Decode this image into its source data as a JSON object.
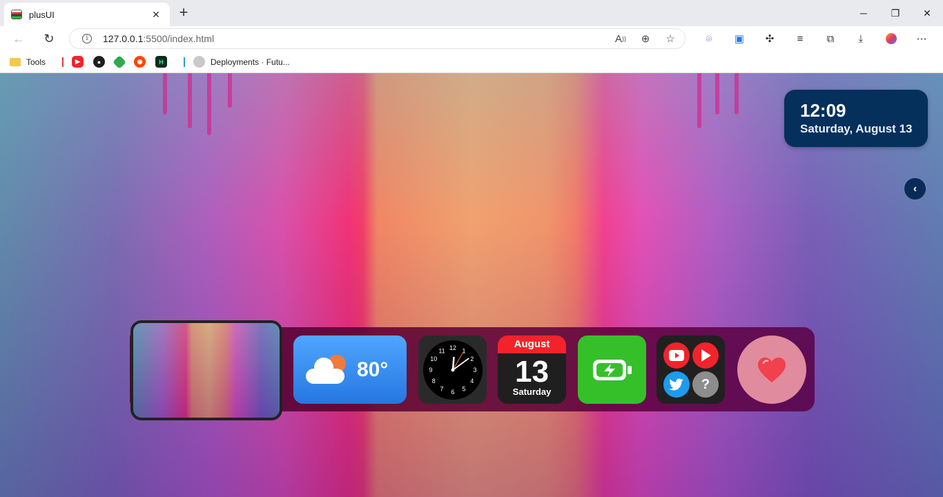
{
  "browser": {
    "tab_title": "plusUI",
    "new_tab_symbol": "+",
    "url_host": "127.0.0.1",
    "url_rest": ":5500/index.html",
    "window_controls": [
      "minimize-icon",
      "restore-icon",
      "close-icon"
    ]
  },
  "bookmarks": {
    "folder_label": "Tools",
    "deployments_label": "Deployments · Futu..."
  },
  "widgets": {
    "clock": {
      "time": "12:09",
      "date": "Saturday, August 13"
    },
    "weather": {
      "temperature": "80°"
    },
    "calendar": {
      "month": "August",
      "day": "13",
      "weekday": "Saturday"
    },
    "analog_clock": {
      "hour": 12,
      "minute": 9,
      "numbers": [
        "12",
        "1",
        "2",
        "3",
        "4",
        "5",
        "6",
        "7",
        "8",
        "9",
        "10",
        "11"
      ]
    },
    "social": {
      "help_symbol": "?"
    }
  },
  "colors": {
    "clock_widget_bg": "#05305c",
    "weather_tile": "#2677e0",
    "calendar_header": "#f2232b",
    "battery_tile": "#35c02a",
    "heart": "#f2404f"
  }
}
